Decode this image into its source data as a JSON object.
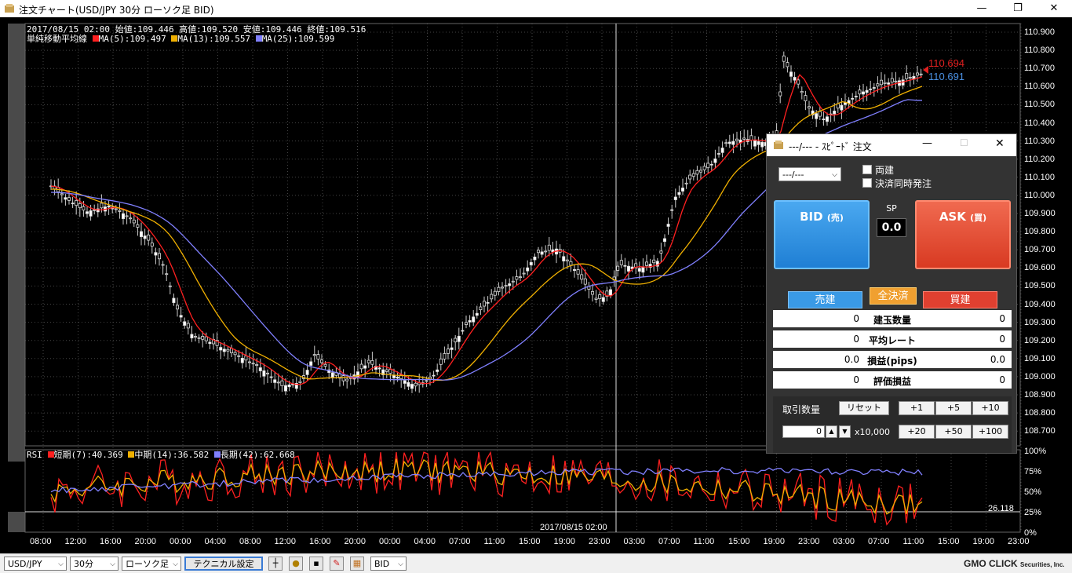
{
  "window": {
    "title": "注文チャート(USD/JPY 30分 ローソク足 BID)",
    "minimize": "—",
    "maximize": "❐",
    "close": "✕"
  },
  "chart": {
    "info_line1": "2017/08/15 02:00 始値:109.446 高値:109.520 安値:109.446 終値:109.516",
    "ma_title": "単純移動平均線",
    "ma_series": [
      {
        "label": "MA(5):109.497",
        "color": "#ff2020"
      },
      {
        "label": "MA(13):109.557",
        "color": "#f0b000"
      },
      {
        "label": "MA(25):109.599",
        "color": "#8080ff"
      }
    ],
    "price_labels": [
      "110.900",
      "110.800",
      "110.700",
      "110.600",
      "110.500",
      "110.400",
      "110.300",
      "110.200",
      "110.100",
      "110.000",
      "109.900",
      "109.800",
      "109.700",
      "109.600",
      "109.500",
      "109.400",
      "109.300",
      "109.200",
      "109.100",
      "109.000",
      "108.900",
      "108.800",
      "108.700"
    ],
    "price_tag_ask": "110.694",
    "price_tag_bid": "110.691",
    "price_tag_ask_color": "#e02020",
    "price_tag_bid_color": "#4a90e2",
    "rsi_title": "RSI",
    "rsi_series": [
      {
        "label": "短期(7):40.369",
        "color": "#ff2020"
      },
      {
        "label": "中期(14):36.582",
        "color": "#f0b000"
      },
      {
        "label": "長期(42):62.668",
        "color": "#8080ff"
      }
    ],
    "rsi_labels": [
      "100%",
      "75%",
      "50%",
      "25%",
      "0%"
    ],
    "rsi_line_value": "26.118",
    "crosshair_time": "2017/08/15 02:00",
    "time_labels": [
      "08:00",
      "12:00",
      "16:00",
      "20:00",
      "00:00",
      "04:00",
      "08:00",
      "12:00",
      "16:00",
      "20:00",
      "00:00",
      "04:00",
      "07:00",
      "11:00",
      "15:00",
      "19:00",
      "23:00",
      "03:00",
      "07:00",
      "11:00",
      "15:00",
      "19:00",
      "23:00",
      "03:00",
      "07:00",
      "11:00",
      "15:00",
      "19:00",
      "23:00"
    ]
  },
  "order_panel": {
    "title": "---/--- - ｽﾋﾟｰﾄﾞ 注文",
    "pair_select": "---/---",
    "checkbox_ryodate": "両建",
    "checkbox_kessai": "決済同時発注",
    "bid_label": "BID",
    "bid_sub": "(売)",
    "ask_label": "ASK",
    "ask_sub": "(買)",
    "sp_label": "SP",
    "sp_value": "0.0",
    "sell_button": "売建",
    "all_close_button": "全決済",
    "buy_button": "買建",
    "rows": [
      {
        "left": "0",
        "center": "建玉数量",
        "right": "0"
      },
      {
        "left": "0",
        "center": "平均レート",
        "right": "0"
      },
      {
        "left": "0.0",
        "center": "損益(pips)",
        "right": "0.0"
      },
      {
        "left": "0",
        "center": "評価損益",
        "right": "0"
      }
    ],
    "qty_label": "取引数量",
    "reset_button": "リセット",
    "qty_value": "0",
    "qty_unit": "x10,000",
    "inc_buttons": [
      "+1",
      "+5",
      "+10",
      "+20",
      "+50",
      "+100"
    ]
  },
  "bottom_bar": {
    "pair": "USD/JPY",
    "period": "30分",
    "chart_type": "ローソク足",
    "technical_button": "テクニカル設定",
    "price_type": "BID",
    "brand": "GMO CLICK",
    "brand_sub": "Securities, Inc."
  }
}
